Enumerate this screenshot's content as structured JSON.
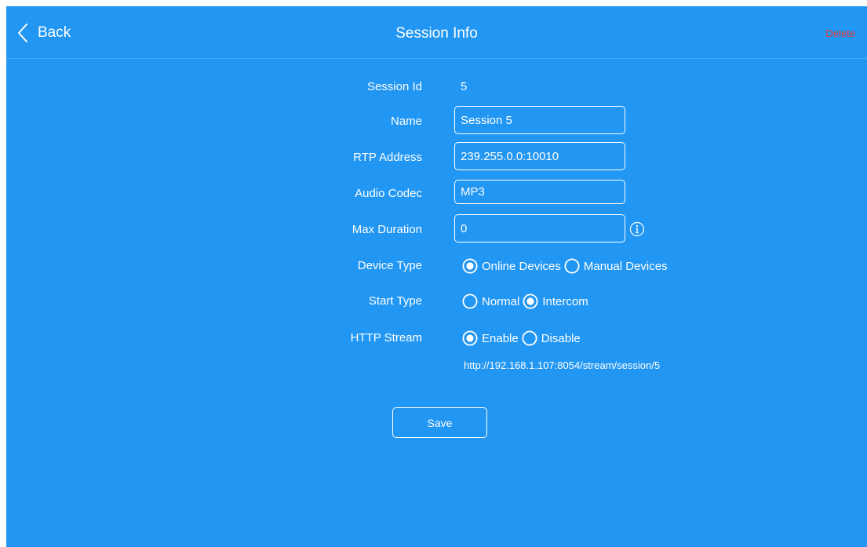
{
  "header": {
    "back_label": "Back",
    "title": "Session Info",
    "delete_label": "Delete",
    "delete_color": "#e53935"
  },
  "theme": {
    "background": "#2196f3",
    "foreground": "#ffffff"
  },
  "form": {
    "session_id": {
      "label": "Session Id",
      "value": "5"
    },
    "name": {
      "label": "Name",
      "value": "Session 5"
    },
    "rtp_address": {
      "label": "RTP Address",
      "value": "239.255.0.0:10010"
    },
    "audio_codec": {
      "label": "Audio Codec",
      "value": "MP3"
    },
    "max_duration": {
      "label": "Max Duration",
      "value": "0",
      "icon": "info-icon"
    },
    "device_type": {
      "label": "Device Type",
      "options": [
        "Online Devices",
        "Manual Devices"
      ],
      "selected": "Online Devices"
    },
    "start_type": {
      "label": "Start Type",
      "options": [
        "Normal",
        "Intercom"
      ],
      "selected": "Intercom"
    },
    "http_stream": {
      "label": "HTTP Stream",
      "options": [
        "Enable",
        "Disable"
      ],
      "selected": "Enable",
      "url": "http://192.168.1.107:8054/stream/session/5"
    },
    "save_label": "Save"
  }
}
